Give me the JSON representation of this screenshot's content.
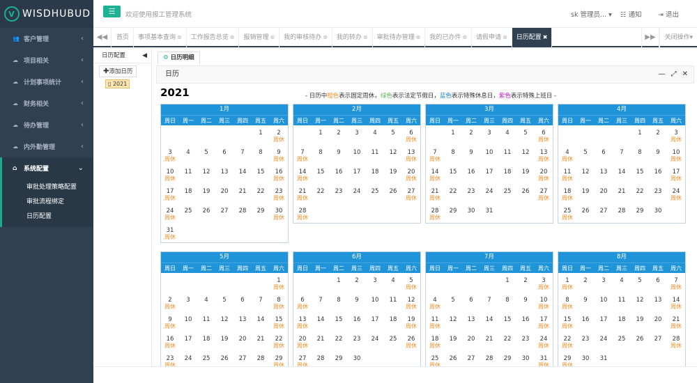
{
  "app": {
    "logo": "WISDHUBUD",
    "welcome": "欢迎使用报工管理系统",
    "user": "sk 管理员...",
    "notify": "通知",
    "logout": "退出"
  },
  "sidebar": {
    "items": [
      {
        "label": "客户管理",
        "icon": "users-icon"
      },
      {
        "label": "项目相关",
        "icon": "cloud-icon"
      },
      {
        "label": "计划事项统计",
        "icon": "cloud-icon"
      },
      {
        "label": "财务相关",
        "icon": "cloud-icon"
      },
      {
        "label": "待办管理",
        "icon": "cloud-icon"
      },
      {
        "label": "内外勤管理",
        "icon": "cloud-icon"
      }
    ],
    "active": {
      "label": "系统配置",
      "icon": "home-icon"
    },
    "subitems": [
      "审批处理策略配置",
      "审批流程绑定",
      "日历配置"
    ]
  },
  "tabs": {
    "items": [
      {
        "label": "首页",
        "closable": false
      },
      {
        "label": "事项基本查询",
        "closable": true
      },
      {
        "label": "工作报告总览",
        "closable": true
      },
      {
        "label": "报销管理",
        "closable": true
      },
      {
        "label": "我的审核待办",
        "closable": true
      },
      {
        "label": "我的转办",
        "closable": true
      },
      {
        "label": "审批待办管理",
        "closable": true
      },
      {
        "label": "我的已办件",
        "closable": true
      },
      {
        "label": "请假申请",
        "closable": true
      },
      {
        "label": "日历配置",
        "closable": true,
        "active": true
      }
    ],
    "close_ops": "关闭操作"
  },
  "leftpane": {
    "title": "日历配置",
    "add_button": "添加日历",
    "node": "2021"
  },
  "rightpane": {
    "subtab": "日历明细",
    "panel_title": "日历",
    "year": "2021",
    "legend": {
      "p1": "- 日历中",
      "orange": "橙色",
      "p2": "表示固定周休，",
      "green": "绿色",
      "p3": "表示法定节假日，",
      "blue": "蓝色",
      "p4": "表示特殊休息日，",
      "purple": "紫色",
      "p5": "表示特殊上班日 -"
    },
    "weekdays": [
      "周日",
      "周一",
      "周二",
      "周三",
      "周四",
      "周五",
      "周六"
    ],
    "rest_label": "周休",
    "months": [
      {
        "name": "1月",
        "first_weekday": 5,
        "days": 31
      },
      {
        "name": "2月",
        "first_weekday": 1,
        "days": 28
      },
      {
        "name": "3月",
        "first_weekday": 1,
        "days": 31
      },
      {
        "name": "4月",
        "first_weekday": 4,
        "days": 30
      },
      {
        "name": "5月",
        "first_weekday": 6,
        "days": 31
      },
      {
        "name": "6月",
        "first_weekday": 2,
        "days": 30
      },
      {
        "name": "7月",
        "first_weekday": 4,
        "days": 31
      },
      {
        "name": "8月",
        "first_weekday": 0,
        "days": 31
      }
    ]
  },
  "colors": {
    "accent": "#1ab394",
    "sidebar": "#2f4050",
    "calendar_header": "#1f94d8",
    "weekend": "#f0922c"
  }
}
